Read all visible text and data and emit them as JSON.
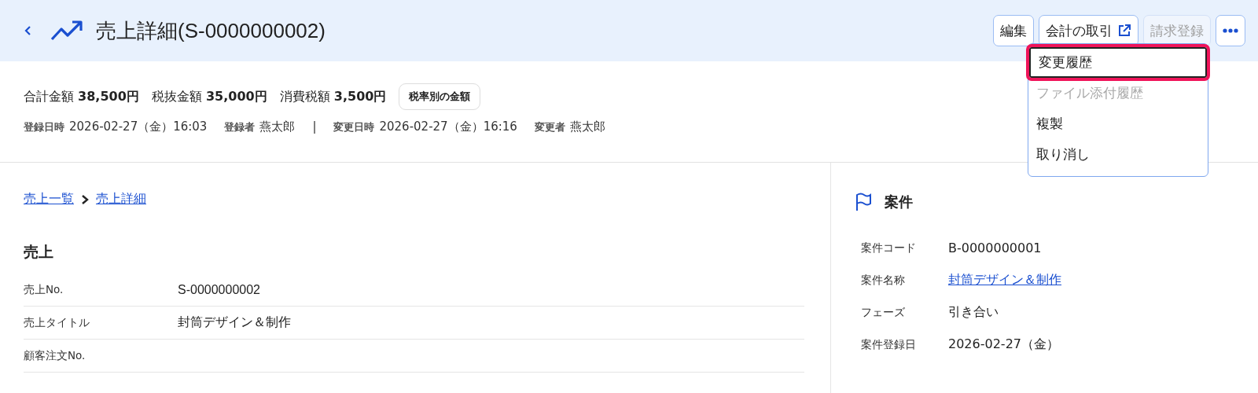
{
  "header": {
    "title": "売上詳細(S-0000000002)",
    "buttons": [
      {
        "label": "編集",
        "kind": "plain",
        "disabled": false
      },
      {
        "label": "会計の取引",
        "kind": "external",
        "disabled": false
      },
      {
        "label": "請求登録",
        "kind": "plain",
        "disabled": true
      },
      {
        "kind": "more",
        "disabled": false
      }
    ]
  },
  "menu": {
    "items": [
      {
        "label": "変更履歴",
        "disabled": false,
        "highlighted": true
      },
      {
        "label": "ファイル添付履歴",
        "disabled": true,
        "highlighted": false
      },
      {
        "label": "複製",
        "disabled": false,
        "highlighted": false
      },
      {
        "label": "取り消し",
        "disabled": false,
        "highlighted": false
      }
    ]
  },
  "summary": {
    "amounts": [
      {
        "label": "合計金額",
        "value": "38,500円"
      },
      {
        "label": "税抜金額",
        "value": "35,000円"
      },
      {
        "label": "消費税額",
        "value": "3,500円"
      }
    ],
    "tax_button": "税率別の金額",
    "meta": [
      {
        "label": "登録日時",
        "value": "2026-02-27（金）16:03"
      },
      {
        "label": "登録者",
        "value": "燕太郎"
      },
      {
        "kind": "separator",
        "value": "|"
      },
      {
        "label": "変更日時",
        "value": "2026-02-27（金）16:16"
      },
      {
        "label": "変更者",
        "value": "燕太郎"
      }
    ]
  },
  "breadcrumb": [
    "売上一覧",
    "売上詳細"
  ],
  "section": {
    "title": "売上",
    "fields": [
      {
        "label": "売上No.",
        "value": "S-0000000002"
      },
      {
        "label": "売上タイトル",
        "value": "封筒デザイン＆制作"
      },
      {
        "label": "顧客注文No."
      }
    ]
  },
  "project": {
    "title": "案件",
    "fields": [
      {
        "label": "案件コード",
        "value": "B-0000000001",
        "kind": "text"
      },
      {
        "label": "案件名称",
        "value": "封筒デザイン＆制作",
        "kind": "link"
      },
      {
        "label": "フェーズ",
        "value": "引き合い",
        "kind": "text"
      },
      {
        "label": "案件登録日",
        "value": "2026-02-27（金）",
        "kind": "text"
      }
    ]
  }
}
